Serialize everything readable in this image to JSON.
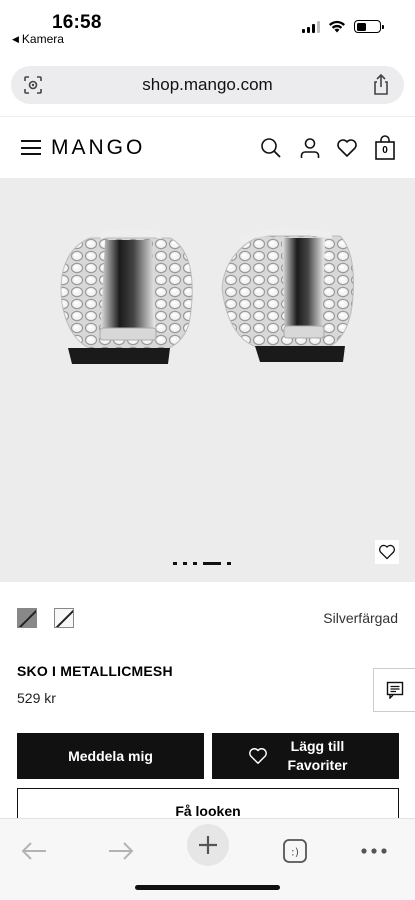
{
  "status_bar": {
    "time": "16:58",
    "back_app": "Kamera"
  },
  "browser": {
    "url": "shop.mango.com"
  },
  "site": {
    "logo": "MANGO",
    "cart_count": "0"
  },
  "gallery": {
    "image_alt": "Silver metallic mesh flat shoes, back view",
    "slide_count": 4,
    "active_slide": 3
  },
  "product": {
    "color_name": "Silverfärgad",
    "title": "SKO I METALLICMESH",
    "price": "529 kr",
    "swatches": [
      "dark-gray",
      "light-silver"
    ]
  },
  "actions": {
    "notify_label": "Meddela mig",
    "favorite_label_line1": "Lägg till",
    "favorite_label_line2": "Favoriter",
    "look_label": "Få looken"
  },
  "colors": {
    "button_dark": "#111111",
    "gallery_bg": "#ececec",
    "url_bar_bg": "#ececee"
  },
  "icons": [
    "camera-lens-icon",
    "share-icon",
    "menu-icon",
    "search-icon",
    "user-icon",
    "heart-icon",
    "bag-icon",
    "chat-icon",
    "back-arrow-icon",
    "forward-arrow-icon",
    "new-tab-icon",
    "tabs-icon",
    "more-icon"
  ]
}
